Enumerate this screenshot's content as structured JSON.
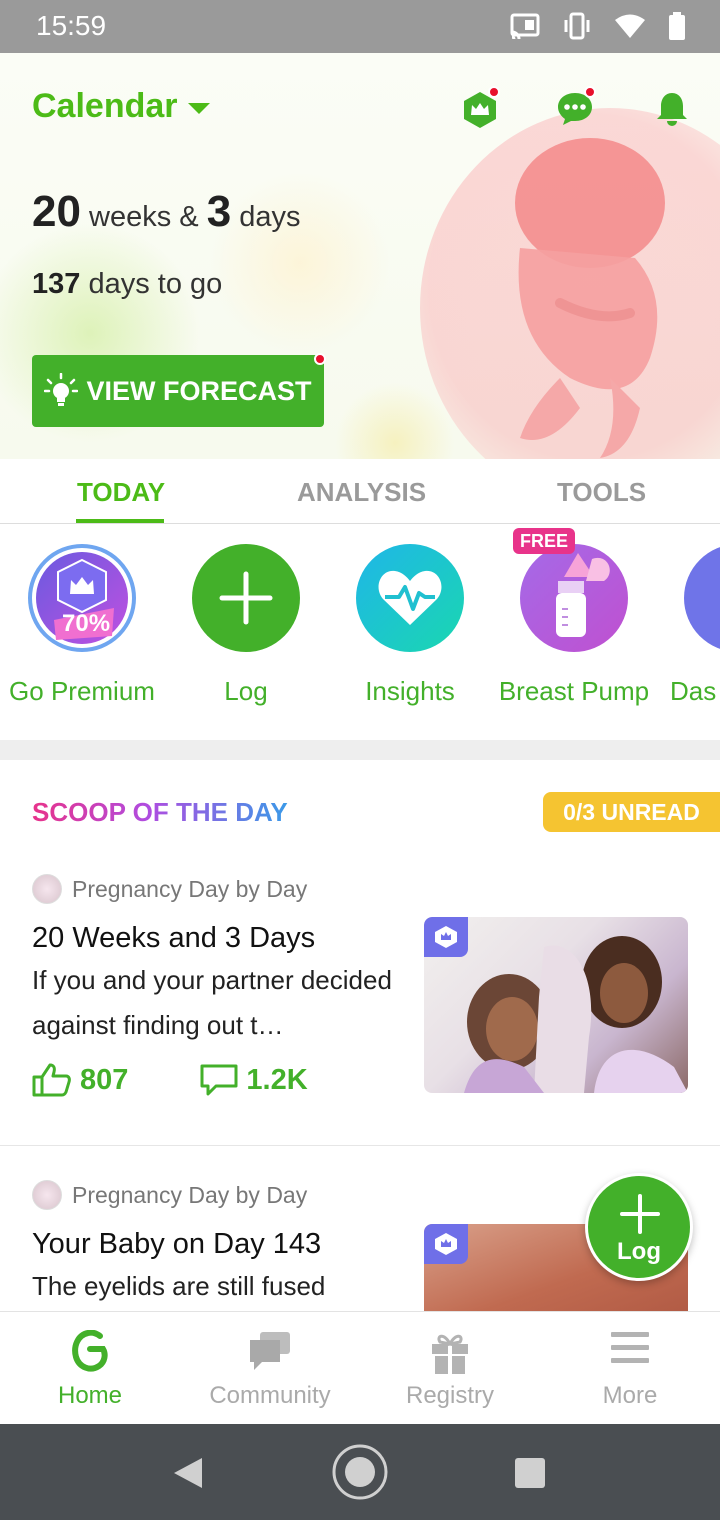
{
  "status_bar": {
    "time": "15:59",
    "icons": [
      "cast-icon",
      "vibrate-icon",
      "wifi-icon",
      "battery-icon"
    ]
  },
  "header": {
    "calendar_label": "Calendar",
    "weeks_number": "20",
    "weeks_word": "weeks &",
    "days_number": "3",
    "days_word": "days",
    "days_to_go_number": "137",
    "days_to_go_text": "days to go",
    "forecast_button": "VIEW FORECAST",
    "icons": [
      "premium-crown-icon",
      "chat-icon",
      "bell-icon"
    ]
  },
  "tabs": [
    {
      "label": "TODAY",
      "active": true
    },
    {
      "label": "ANALYSIS",
      "active": false
    },
    {
      "label": "TOOLS",
      "active": false
    }
  ],
  "quick_actions": [
    {
      "label": "Go Premium",
      "badge": "70%"
    },
    {
      "label": "Log"
    },
    {
      "label": "Insights"
    },
    {
      "label": "Breast Pump",
      "tag": "FREE"
    },
    {
      "label": "Das"
    }
  ],
  "scoop": {
    "title": "SCOOP OF THE DAY",
    "unread": "0/3 UNREAD",
    "articles": [
      {
        "source": "Pregnancy Day by Day",
        "title": "20 Weeks and 3 Days",
        "snippet": "If you and your partner decided against finding out t…",
        "likes": "807",
        "comments": "1.2K"
      },
      {
        "source": "Pregnancy Day by Day",
        "title": "Your Baby on Day 143",
        "snippet": "The eyelids are still fused"
      }
    ]
  },
  "fab": {
    "label": "Log"
  },
  "bottom_nav": [
    {
      "label": "Home",
      "active": true
    },
    {
      "label": "Community",
      "active": false
    },
    {
      "label": "Registry",
      "active": false
    },
    {
      "label": "More",
      "active": false
    }
  ],
  "colors": {
    "brand_green": "#43b02a",
    "accent_red": "#e8102c",
    "unread_yellow": "#f5c431",
    "free_pink": "#e8338a"
  }
}
